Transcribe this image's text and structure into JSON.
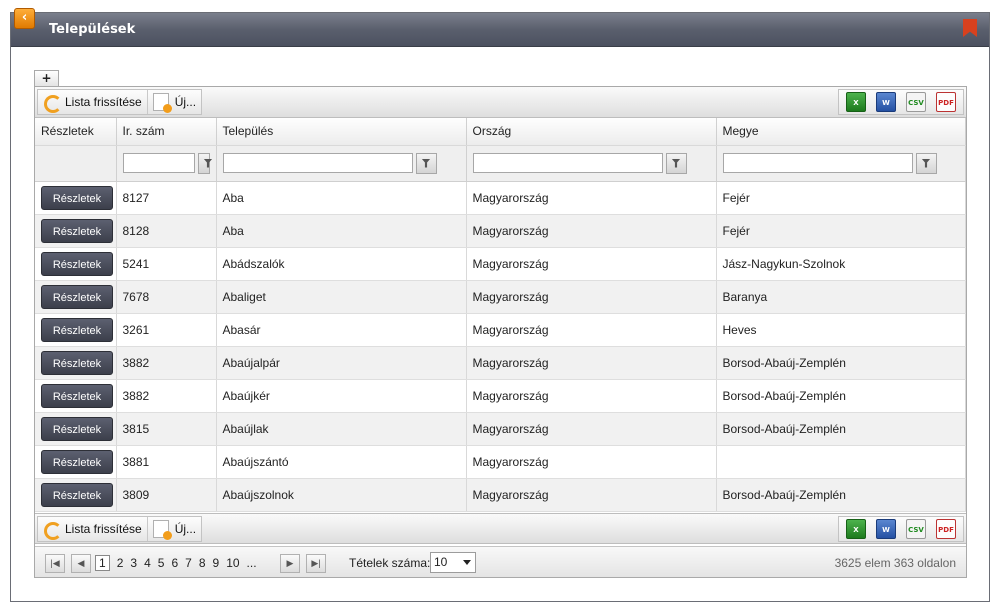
{
  "window": {
    "title": "Települések"
  },
  "toolbar": {
    "refresh_label": "Lista frissítése",
    "new_label": "Új..."
  },
  "export": {
    "xls": "X",
    "doc": "W",
    "csv": "CSV",
    "pdf": "PDF"
  },
  "add_tab": "+",
  "table": {
    "columns": [
      "Részletek",
      "Ir. szám",
      "Település",
      "Ország",
      "Megye"
    ],
    "button_label": "Részletek",
    "rows": [
      [
        "8127",
        "Aba",
        "Magyarország",
        "Fejér"
      ],
      [
        "8128",
        "Aba",
        "Magyarország",
        "Fejér"
      ],
      [
        "5241",
        "Abádszalók",
        "Magyarország",
        "Jász-Nagykun-Szolnok"
      ],
      [
        "7678",
        "Abaliget",
        "Magyarország",
        "Baranya"
      ],
      [
        "3261",
        "Abasár",
        "Magyarország",
        "Heves"
      ],
      [
        "3882",
        "Abaújalpár",
        "Magyarország",
        "Borsod-Abaúj-Zemplén"
      ],
      [
        "3882",
        "Abaújkér",
        "Magyarország",
        "Borsod-Abaúj-Zemplén"
      ],
      [
        "3815",
        "Abaújlak",
        "Magyarország",
        "Borsod-Abaúj-Zemplén"
      ],
      [
        "3881",
        "Abaújszántó",
        "Magyarország",
        ""
      ],
      [
        "3809",
        "Abaújszolnok",
        "Magyarország",
        "Borsod-Abaúj-Zemplén"
      ]
    ]
  },
  "pager": {
    "pages": [
      "1",
      "2",
      "3",
      "4",
      "5",
      "6",
      "7",
      "8",
      "9",
      "10",
      "..."
    ],
    "current": "1",
    "page_size_label": "Tételek száma:",
    "page_size": "10",
    "info": "3625 elem 363 oldalon"
  }
}
